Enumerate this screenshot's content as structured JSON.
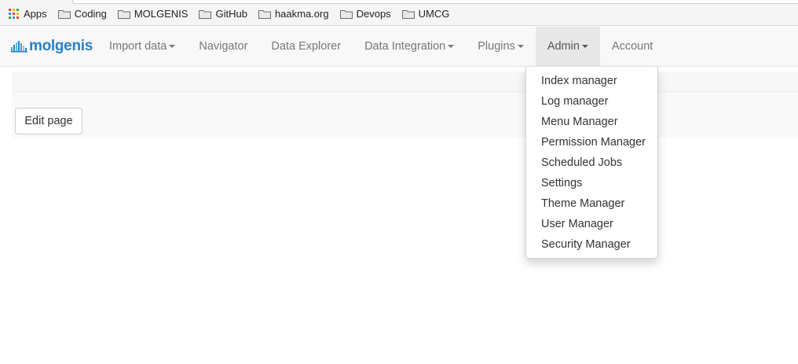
{
  "bookmarks": {
    "items": [
      {
        "label": "Apps",
        "icon": "apps-grid-icon"
      },
      {
        "label": "Coding",
        "icon": "folder-icon"
      },
      {
        "label": "MOLGENIS",
        "icon": "folder-icon"
      },
      {
        "label": "GitHub",
        "icon": "folder-icon"
      },
      {
        "label": "haakma.org",
        "icon": "folder-icon"
      },
      {
        "label": "Devops",
        "icon": "folder-icon"
      },
      {
        "label": "UMCG",
        "icon": "folder-icon"
      }
    ]
  },
  "navbar": {
    "brand": "molgenis",
    "brand_color": "#2a7fc3",
    "items": [
      {
        "label": "Import data",
        "dropdown": true
      },
      {
        "label": "Navigator",
        "dropdown": false
      },
      {
        "label": "Data Explorer",
        "dropdown": false
      },
      {
        "label": "Data Integration",
        "dropdown": true
      },
      {
        "label": "Plugins",
        "dropdown": true
      },
      {
        "label": "Admin",
        "dropdown": true,
        "active": true
      },
      {
        "label": "Account",
        "dropdown": false
      }
    ]
  },
  "page": {
    "edit_button_label": "Edit page"
  },
  "admin_menu": {
    "items": [
      "Index manager",
      "Log manager",
      "Menu Manager",
      "Permission Manager",
      "Scheduled Jobs",
      "Settings",
      "Theme Manager",
      "User Manager",
      "Security Manager"
    ]
  }
}
